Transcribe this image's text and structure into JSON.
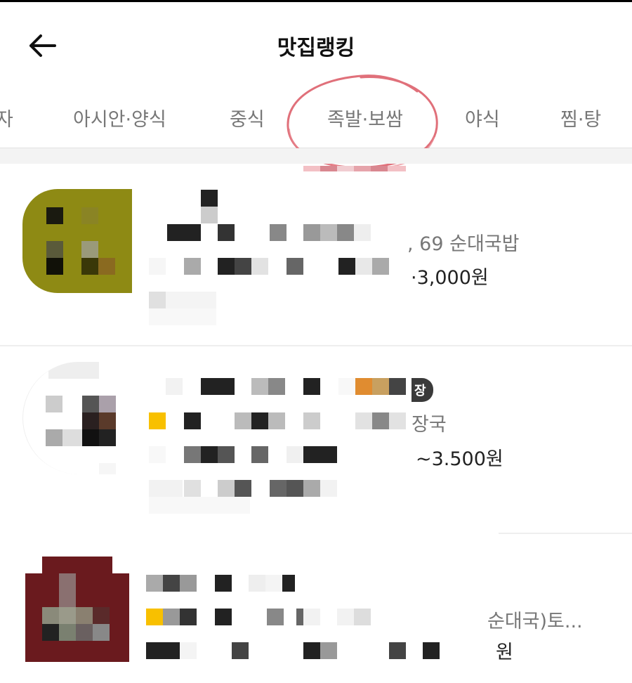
{
  "header": {
    "title": "맛집랭킹",
    "back_icon": "back-arrow-icon"
  },
  "tabs": [
    {
      "label": "자"
    },
    {
      "label": "아시안·양식"
    },
    {
      "label": "중식"
    },
    {
      "label": "족발·보쌈",
      "annotated": true
    },
    {
      "label": "야식"
    },
    {
      "label": "찜·탕"
    }
  ],
  "annotation_color": "#e0707a",
  "restaurants": [
    {
      "category_text": ", 69 순대국밥",
      "price_text": "·3,000원",
      "badge": ""
    },
    {
      "category_text": "장국",
      "price_text": "~3.500원",
      "badge": "장"
    },
    {
      "category_text": "순대국)토...",
      "price_text": "원",
      "badge": ""
    }
  ]
}
